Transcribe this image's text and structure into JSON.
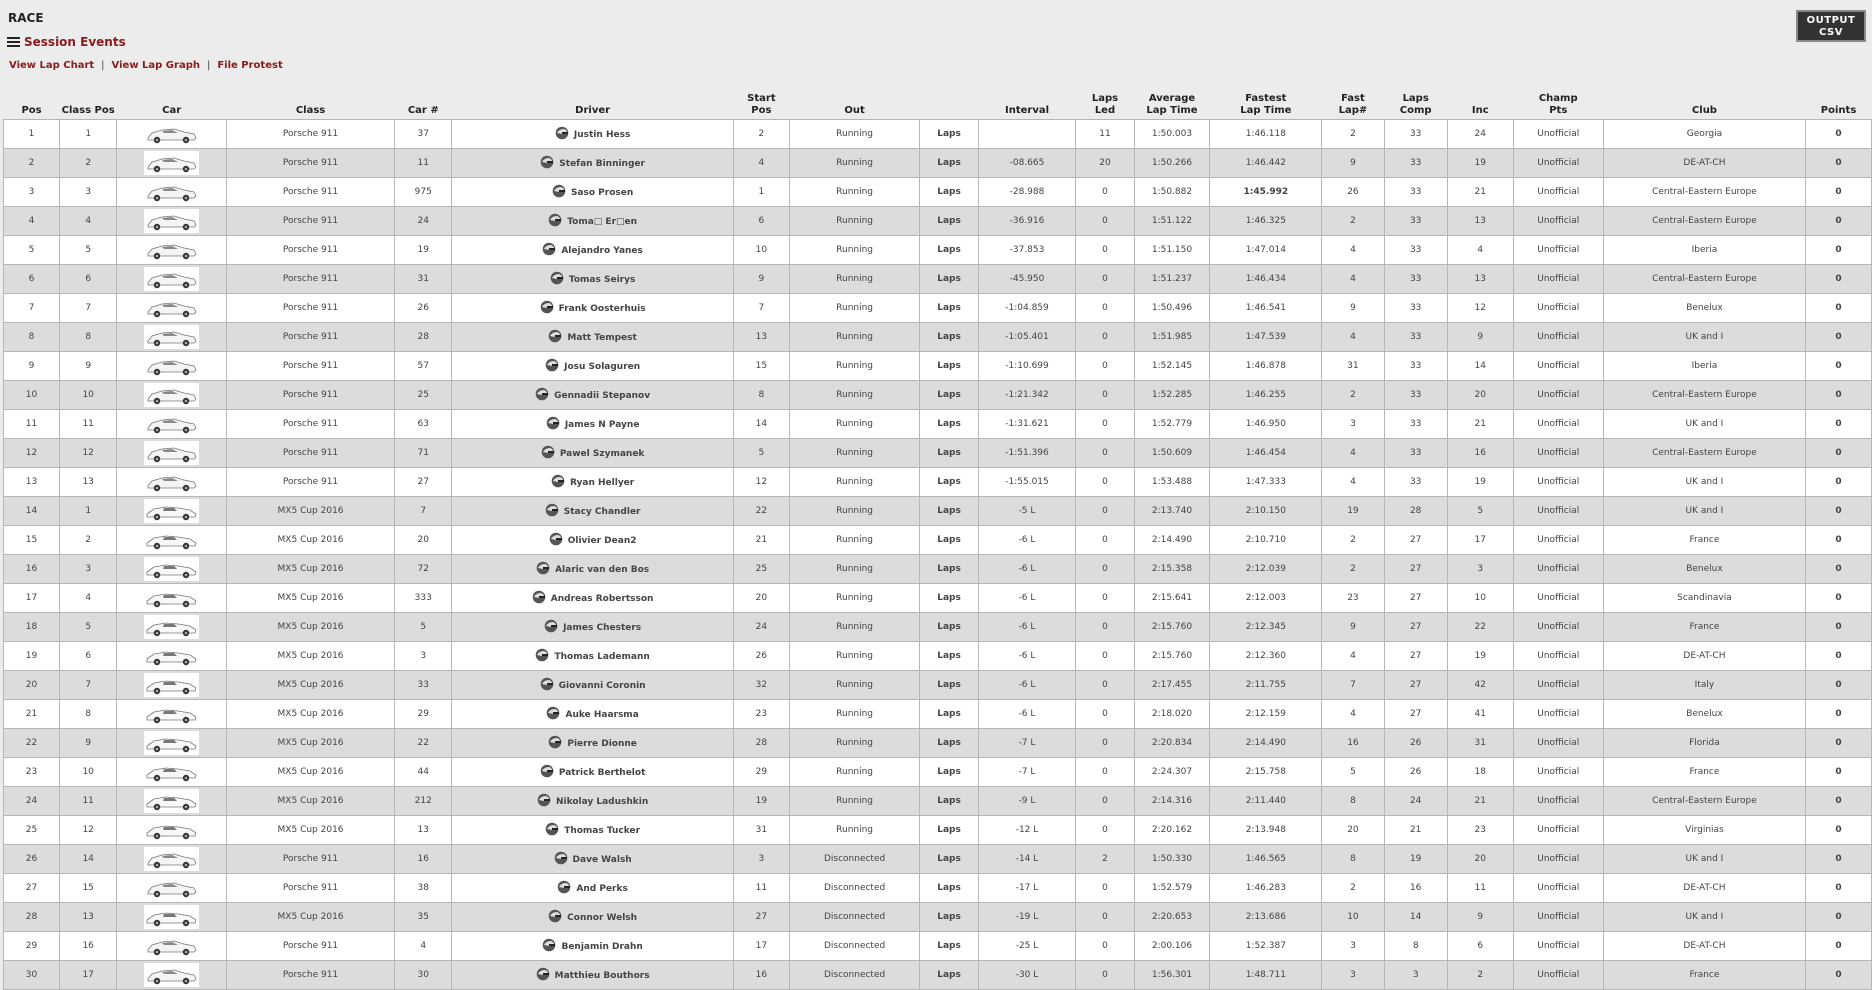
{
  "header": {
    "title": "RACE",
    "session_events": "Session Events",
    "output_btn_line1": "OUTPUT",
    "output_btn_line2": "CSV"
  },
  "links": [
    "View Lap Chart",
    "View Lap Graph",
    "File Protest"
  ],
  "columns": [
    {
      "l1": "",
      "l2": "Pos"
    },
    {
      "l1": "",
      "l2": "Class Pos"
    },
    {
      "l1": "",
      "l2": "Car"
    },
    {
      "l1": "",
      "l2": "Class"
    },
    {
      "l1": "",
      "l2": "Car #"
    },
    {
      "l1": "",
      "l2": "Driver"
    },
    {
      "l1": "Start",
      "l2": "Pos"
    },
    {
      "l1": "",
      "l2": "Out"
    },
    {
      "l1": "",
      "l2": ""
    },
    {
      "l1": "",
      "l2": "Interval"
    },
    {
      "l1": "Laps",
      "l2": "Led"
    },
    {
      "l1": "Average",
      "l2": "Lap Time"
    },
    {
      "l1": "Fastest",
      "l2": "Lap Time"
    },
    {
      "l1": "Fast",
      "l2": "Lap#"
    },
    {
      "l1": "Laps",
      "l2": "Comp"
    },
    {
      "l1": "",
      "l2": "Inc"
    },
    {
      "l1": "Champ",
      "l2": "Pts"
    },
    {
      "l1": "",
      "l2": "Club"
    },
    {
      "l1": "",
      "l2": "Points"
    }
  ],
  "laps_label": "Laps",
  "fastest_overall": "1:45.992",
  "rows": [
    [
      "1",
      "1",
      "Porsche 911",
      "37",
      "Justin Hess",
      "2",
      "Running",
      "",
      "11",
      "1:50.003",
      "1:46.118",
      "2",
      "33",
      "24",
      "Unofficial",
      "Georgia",
      "0"
    ],
    [
      "2",
      "2",
      "Porsche 911",
      "11",
      "Stefan Binninger",
      "4",
      "Running",
      "-08.665",
      "20",
      "1:50.266",
      "1:46.442",
      "9",
      "33",
      "19",
      "Unofficial",
      "DE-AT-CH",
      "0"
    ],
    [
      "3",
      "3",
      "Porsche 911",
      "975",
      "Saso Prosen",
      "1",
      "Running",
      "-28.988",
      "0",
      "1:50.882",
      "1:45.992",
      "26",
      "33",
      "21",
      "Unofficial",
      "Central-Eastern Europe",
      "0"
    ],
    [
      "4",
      "4",
      "Porsche 911",
      "24",
      "Toma□ Er□en",
      "6",
      "Running",
      "-36.916",
      "0",
      "1:51.122",
      "1:46.325",
      "2",
      "33",
      "13",
      "Unofficial",
      "Central-Eastern Europe",
      "0"
    ],
    [
      "5",
      "5",
      "Porsche 911",
      "19",
      "Alejandro Yanes",
      "10",
      "Running",
      "-37.853",
      "0",
      "1:51.150",
      "1:47.014",
      "4",
      "33",
      "4",
      "Unofficial",
      "Iberia",
      "0"
    ],
    [
      "6",
      "6",
      "Porsche 911",
      "31",
      "Tomas Seirys",
      "9",
      "Running",
      "-45.950",
      "0",
      "1:51.237",
      "1:46.434",
      "4",
      "33",
      "13",
      "Unofficial",
      "Central-Eastern Europe",
      "0"
    ],
    [
      "7",
      "7",
      "Porsche 911",
      "26",
      "Frank Oosterhuis",
      "7",
      "Running",
      "-1:04.859",
      "0",
      "1:50.496",
      "1:46.541",
      "9",
      "33",
      "12",
      "Unofficial",
      "Benelux",
      "0"
    ],
    [
      "8",
      "8",
      "Porsche 911",
      "28",
      "Matt Tempest",
      "13",
      "Running",
      "-1:05.401",
      "0",
      "1:51.985",
      "1:47.539",
      "4",
      "33",
      "9",
      "Unofficial",
      "UK and I",
      "0"
    ],
    [
      "9",
      "9",
      "Porsche 911",
      "57",
      "Josu Solaguren",
      "15",
      "Running",
      "-1:10.699",
      "0",
      "1:52.145",
      "1:46.878",
      "31",
      "33",
      "14",
      "Unofficial",
      "Iberia",
      "0"
    ],
    [
      "10",
      "10",
      "Porsche 911",
      "25",
      "Gennadii Stepanov",
      "8",
      "Running",
      "-1:21.342",
      "0",
      "1:52.285",
      "1:46.255",
      "2",
      "33",
      "20",
      "Unofficial",
      "Central-Eastern Europe",
      "0"
    ],
    [
      "11",
      "11",
      "Porsche 911",
      "63",
      "James N Payne",
      "14",
      "Running",
      "-1:31.621",
      "0",
      "1:52.779",
      "1:46.950",
      "3",
      "33",
      "21",
      "Unofficial",
      "UK and I",
      "0"
    ],
    [
      "12",
      "12",
      "Porsche 911",
      "71",
      "Pawel Szymanek",
      "5",
      "Running",
      "-1:51.396",
      "0",
      "1:50.609",
      "1:46.454",
      "4",
      "33",
      "16",
      "Unofficial",
      "Central-Eastern Europe",
      "0"
    ],
    [
      "13",
      "13",
      "Porsche 911",
      "27",
      "Ryan Hellyer",
      "12",
      "Running",
      "-1:55.015",
      "0",
      "1:53.488",
      "1:47.333",
      "4",
      "33",
      "19",
      "Unofficial",
      "UK and I",
      "0"
    ],
    [
      "14",
      "1",
      "MX5 Cup 2016",
      "7",
      "Stacy Chandler",
      "22",
      "Running",
      "-5 L",
      "0",
      "2:13.740",
      "2:10.150",
      "19",
      "28",
      "5",
      "Unofficial",
      "UK and I",
      "0"
    ],
    [
      "15",
      "2",
      "MX5 Cup 2016",
      "20",
      "Olivier Dean2",
      "21",
      "Running",
      "-6 L",
      "0",
      "2:14.490",
      "2:10.710",
      "2",
      "27",
      "17",
      "Unofficial",
      "France",
      "0"
    ],
    [
      "16",
      "3",
      "MX5 Cup 2016",
      "72",
      "Alaric van den Bos",
      "25",
      "Running",
      "-6 L",
      "0",
      "2:15.358",
      "2:12.039",
      "2",
      "27",
      "3",
      "Unofficial",
      "Benelux",
      "0"
    ],
    [
      "17",
      "4",
      "MX5 Cup 2016",
      "333",
      "Andreas Robertsson",
      "20",
      "Running",
      "-6 L",
      "0",
      "2:15.641",
      "2:12.003",
      "23",
      "27",
      "10",
      "Unofficial",
      "Scandinavia",
      "0"
    ],
    [
      "18",
      "5",
      "MX5 Cup 2016",
      "5",
      "James Chesters",
      "24",
      "Running",
      "-6 L",
      "0",
      "2:15.760",
      "2:12.345",
      "9",
      "27",
      "22",
      "Unofficial",
      "France",
      "0"
    ],
    [
      "19",
      "6",
      "MX5 Cup 2016",
      "3",
      "Thomas Lademann",
      "26",
      "Running",
      "-6 L",
      "0",
      "2:15.760",
      "2:12.360",
      "4",
      "27",
      "19",
      "Unofficial",
      "DE-AT-CH",
      "0"
    ],
    [
      "20",
      "7",
      "MX5 Cup 2016",
      "33",
      "Giovanni Coronin",
      "32",
      "Running",
      "-6 L",
      "0",
      "2:17.455",
      "2:11.755",
      "7",
      "27",
      "42",
      "Unofficial",
      "Italy",
      "0"
    ],
    [
      "21",
      "8",
      "MX5 Cup 2016",
      "29",
      "Auke Haarsma",
      "23",
      "Running",
      "-6 L",
      "0",
      "2:18.020",
      "2:12.159",
      "4",
      "27",
      "41",
      "Unofficial",
      "Benelux",
      "0"
    ],
    [
      "22",
      "9",
      "MX5 Cup 2016",
      "22",
      "Pierre Dionne",
      "28",
      "Running",
      "-7 L",
      "0",
      "2:20.834",
      "2:14.490",
      "16",
      "26",
      "31",
      "Unofficial",
      "Florida",
      "0"
    ],
    [
      "23",
      "10",
      "MX5 Cup 2016",
      "44",
      "Patrick Berthelot",
      "29",
      "Running",
      "-7 L",
      "0",
      "2:24.307",
      "2:15.758",
      "5",
      "26",
      "18",
      "Unofficial",
      "France",
      "0"
    ],
    [
      "24",
      "11",
      "MX5 Cup 2016",
      "212",
      "Nikolay Ladushkin",
      "19",
      "Running",
      "-9 L",
      "0",
      "2:14.316",
      "2:11.440",
      "8",
      "24",
      "21",
      "Unofficial",
      "Central-Eastern Europe",
      "0"
    ],
    [
      "25",
      "12",
      "MX5 Cup 2016",
      "13",
      "Thomas Tucker",
      "31",
      "Running",
      "-12 L",
      "0",
      "2:20.162",
      "2:13.948",
      "20",
      "21",
      "23",
      "Unofficial",
      "Virginias",
      "0"
    ],
    [
      "26",
      "14",
      "Porsche 911",
      "16",
      "Dave Walsh",
      "3",
      "Disconnected",
      "-14 L",
      "2",
      "1:50.330",
      "1:46.565",
      "8",
      "19",
      "20",
      "Unofficial",
      "UK and I",
      "0"
    ],
    [
      "27",
      "15",
      "Porsche 911",
      "38",
      "And Perks",
      "11",
      "Disconnected",
      "-17 L",
      "0",
      "1:52.579",
      "1:46.283",
      "2",
      "16",
      "11",
      "Unofficial",
      "DE-AT-CH",
      "0"
    ],
    [
      "28",
      "13",
      "MX5 Cup 2016",
      "35",
      "Connor Welsh",
      "27",
      "Disconnected",
      "-19 L",
      "0",
      "2:20.653",
      "2:13.686",
      "10",
      "14",
      "9",
      "Unofficial",
      "UK and I",
      "0"
    ],
    [
      "29",
      "16",
      "Porsche 911",
      "4",
      "Benjamin Drahn",
      "17",
      "Disconnected",
      "-25 L",
      "0",
      "2:00.106",
      "1:52.387",
      "3",
      "8",
      "6",
      "Unofficial",
      "DE-AT-CH",
      "0"
    ],
    [
      "30",
      "17",
      "Porsche 911",
      "30",
      "Matthieu Bouthors",
      "16",
      "Disconnected",
      "-30 L",
      "0",
      "1:56.301",
      "1:48.711",
      "3",
      "3",
      "2",
      "Unofficial",
      "France",
      "0"
    ]
  ]
}
